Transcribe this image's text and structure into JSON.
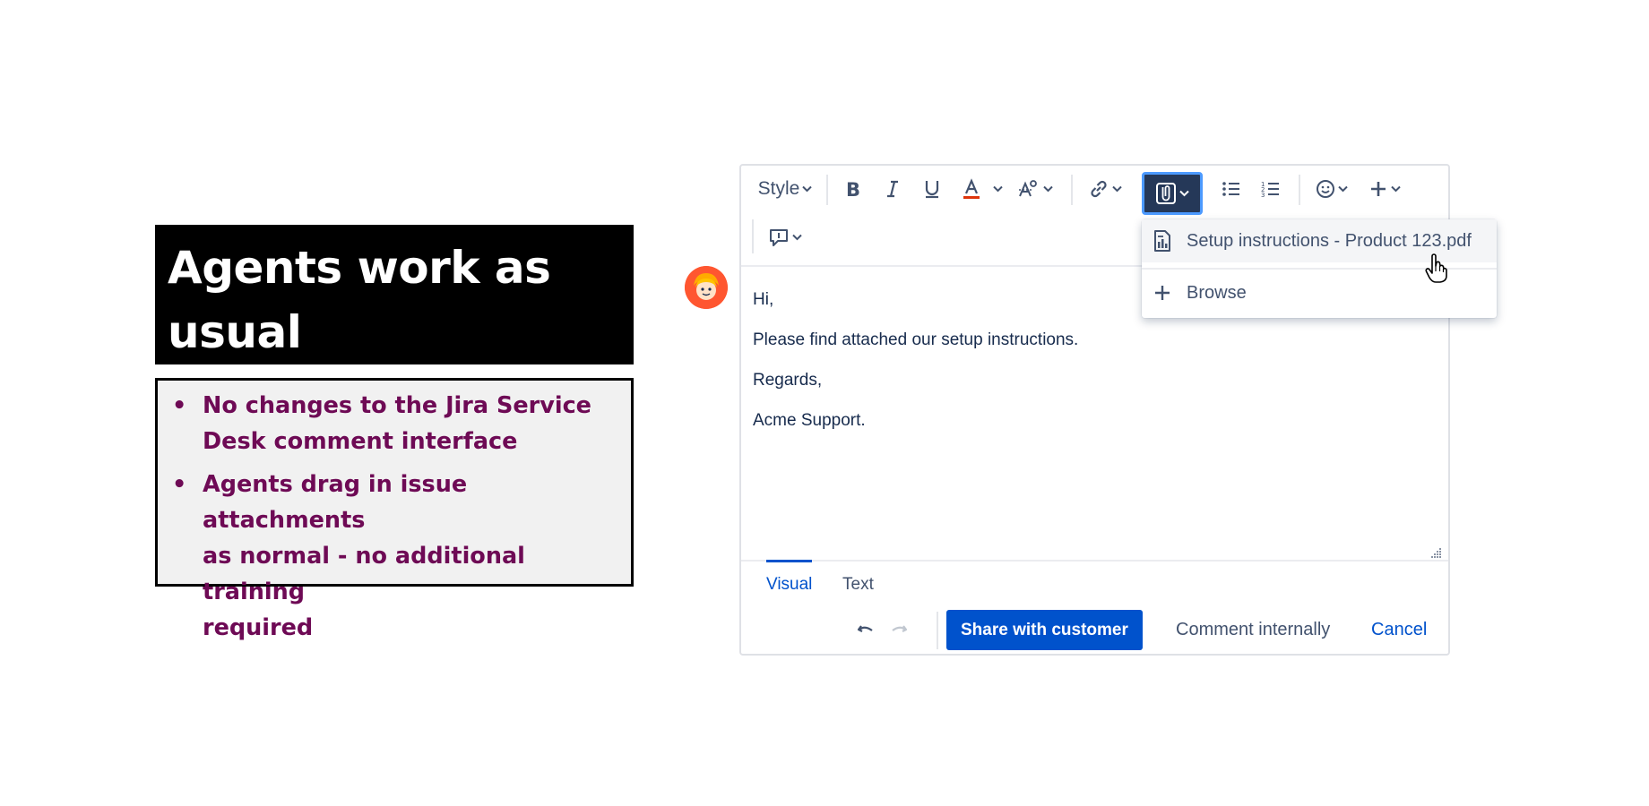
{
  "slide": {
    "title_line1": "Agents work as",
    "title_line2": "usual",
    "bullets": [
      {
        "lines": [
          "No changes to the Jira Service",
          "Desk comment interface"
        ]
      },
      {
        "lines": [
          "Agents drag in issue attachments",
          "as normal - no additional training",
          "required"
        ]
      }
    ],
    "bullet_char": "•"
  },
  "toolbar": {
    "style_label": "Style",
    "buttons": [
      "bold-icon",
      "italic-icon",
      "underline-icon",
      "text-color-icon",
      "text-format-icon",
      "link-icon",
      "attachment-icon",
      "bullet-list-icon",
      "numbered-list-icon",
      "emoji-icon",
      "plus-icon",
      "comment-template-icon"
    ]
  },
  "dropdown": {
    "items": [
      {
        "label": "Setup instructions - Product 123.pdf",
        "icon": "document-icon"
      },
      {
        "label": "Browse",
        "icon": "plus-icon"
      }
    ]
  },
  "editor": {
    "lines": [
      "Hi,",
      "Please find attached our setup instructions.",
      "Regards,",
      "Acme Support."
    ]
  },
  "tabs": {
    "visual": "Visual",
    "text": "Text",
    "active": "Visual"
  },
  "actions": {
    "share": "Share with customer",
    "internal": "Comment internally",
    "cancel": "Cancel"
  },
  "colors": {
    "primary": "#0052cc",
    "bullet_text": "#6e0a55",
    "avatar_bg": "#ff5630",
    "active_toolbar": "#253858"
  }
}
